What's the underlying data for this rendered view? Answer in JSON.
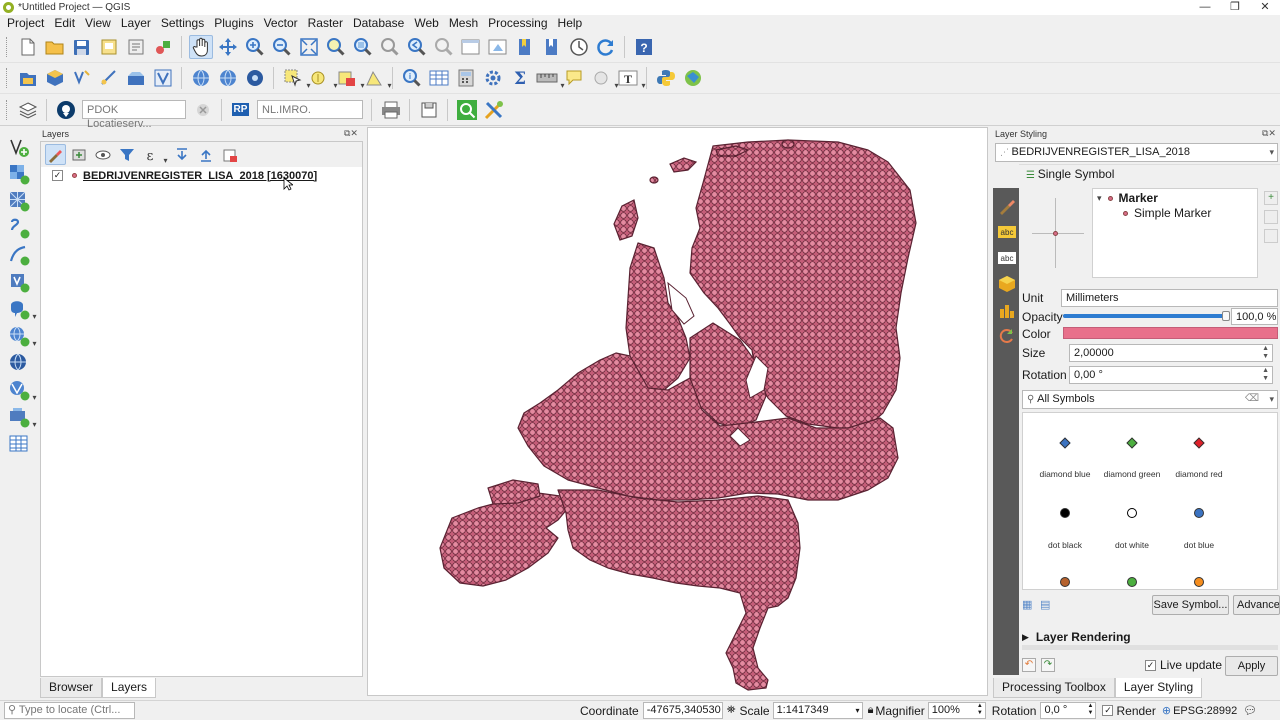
{
  "window": {
    "title": "*Untitled Project — QGIS",
    "min": "—",
    "max": "❐",
    "close": "✕"
  },
  "menu": [
    {
      "label": "Project"
    },
    {
      "label": "Edit"
    },
    {
      "label": "View"
    },
    {
      "label": "Layer"
    },
    {
      "label": "Settings"
    },
    {
      "label": "Plugins"
    },
    {
      "label": "Vector"
    },
    {
      "label": "Raster"
    },
    {
      "label": "Database"
    },
    {
      "label": "Web"
    },
    {
      "label": "Mesh"
    },
    {
      "label": "Processing"
    },
    {
      "label": "Help"
    }
  ],
  "toolbar3": {
    "locator_placeholder": "PDOK Locatieserv...",
    "rp_badge": "RP",
    "imro_placeholder": "NL.IMRO."
  },
  "layers_panel": {
    "title": "Layers",
    "layer": {
      "checked": "✓",
      "name": "BEDRIJVENREGISTER_LISA_2018 [1630070]"
    },
    "tabs": {
      "browser": "Browser",
      "layers": "Layers"
    }
  },
  "styling": {
    "title": "Layer Styling",
    "layer_combo": "BEDRIJVENREGISTER_LISA_2018",
    "renderer": "Single Symbol",
    "tree_marker": "Marker",
    "tree_simple": "Simple Marker",
    "unit_label": "Unit",
    "unit_value": "Millimeters",
    "opacity_label": "Opacity",
    "opacity_value": "100,0 %",
    "opacity_fraction": 1.0,
    "color_label": "Color",
    "color_value": "#e8708b",
    "size_label": "Size",
    "size_value": "2,00000",
    "rotation_label": "Rotation",
    "rotation_value": "0,00 °",
    "symbols_filter": "All Symbols",
    "symbols": [
      {
        "name": "diamond blue",
        "shape": "diamond",
        "color": "#3b73c1"
      },
      {
        "name": "diamond green",
        "shape": "diamond",
        "color": "#4caf3f"
      },
      {
        "name": "diamond red",
        "shape": "diamond",
        "color": "#e0202a"
      },
      {
        "name": "dot  black",
        "shape": "dot",
        "color": "#000000"
      },
      {
        "name": "dot  white",
        "shape": "dot",
        "color": "#ffffff"
      },
      {
        "name": "dot blue",
        "shape": "dot",
        "color": "#3b73c1"
      },
      {
        "name": "",
        "shape": "dot",
        "color": "#b5612c"
      },
      {
        "name": "",
        "shape": "dot",
        "color": "#4caf3f"
      },
      {
        "name": "",
        "shape": "dot",
        "color": "#f58d1e"
      }
    ],
    "save_symbol": "Save Symbol...",
    "advanced": "Advance",
    "layer_rendering": "Layer Rendering",
    "live_update": "Live update",
    "apply": "Apply",
    "tab_toolbox": "Processing Toolbox",
    "tab_styling": "Layer Styling"
  },
  "status": {
    "locate_placeholder": "Type to locate (Ctrl...",
    "coordinate_label": "Coordinate",
    "coordinate_value": "-47675,340530",
    "scale_label": "Scale",
    "scale_value": "1:1417349",
    "magnifier_label": "Magnifier",
    "magnifier_value": "100%",
    "rotation_label": "Rotation",
    "rotation_value": "0,0 °",
    "render_label": "Render",
    "crs": "EPSG:28992"
  },
  "colors": {
    "layer_fill": "#d96d88",
    "layer_stroke": "#5a2232",
    "accent": "#2e7cd1"
  }
}
